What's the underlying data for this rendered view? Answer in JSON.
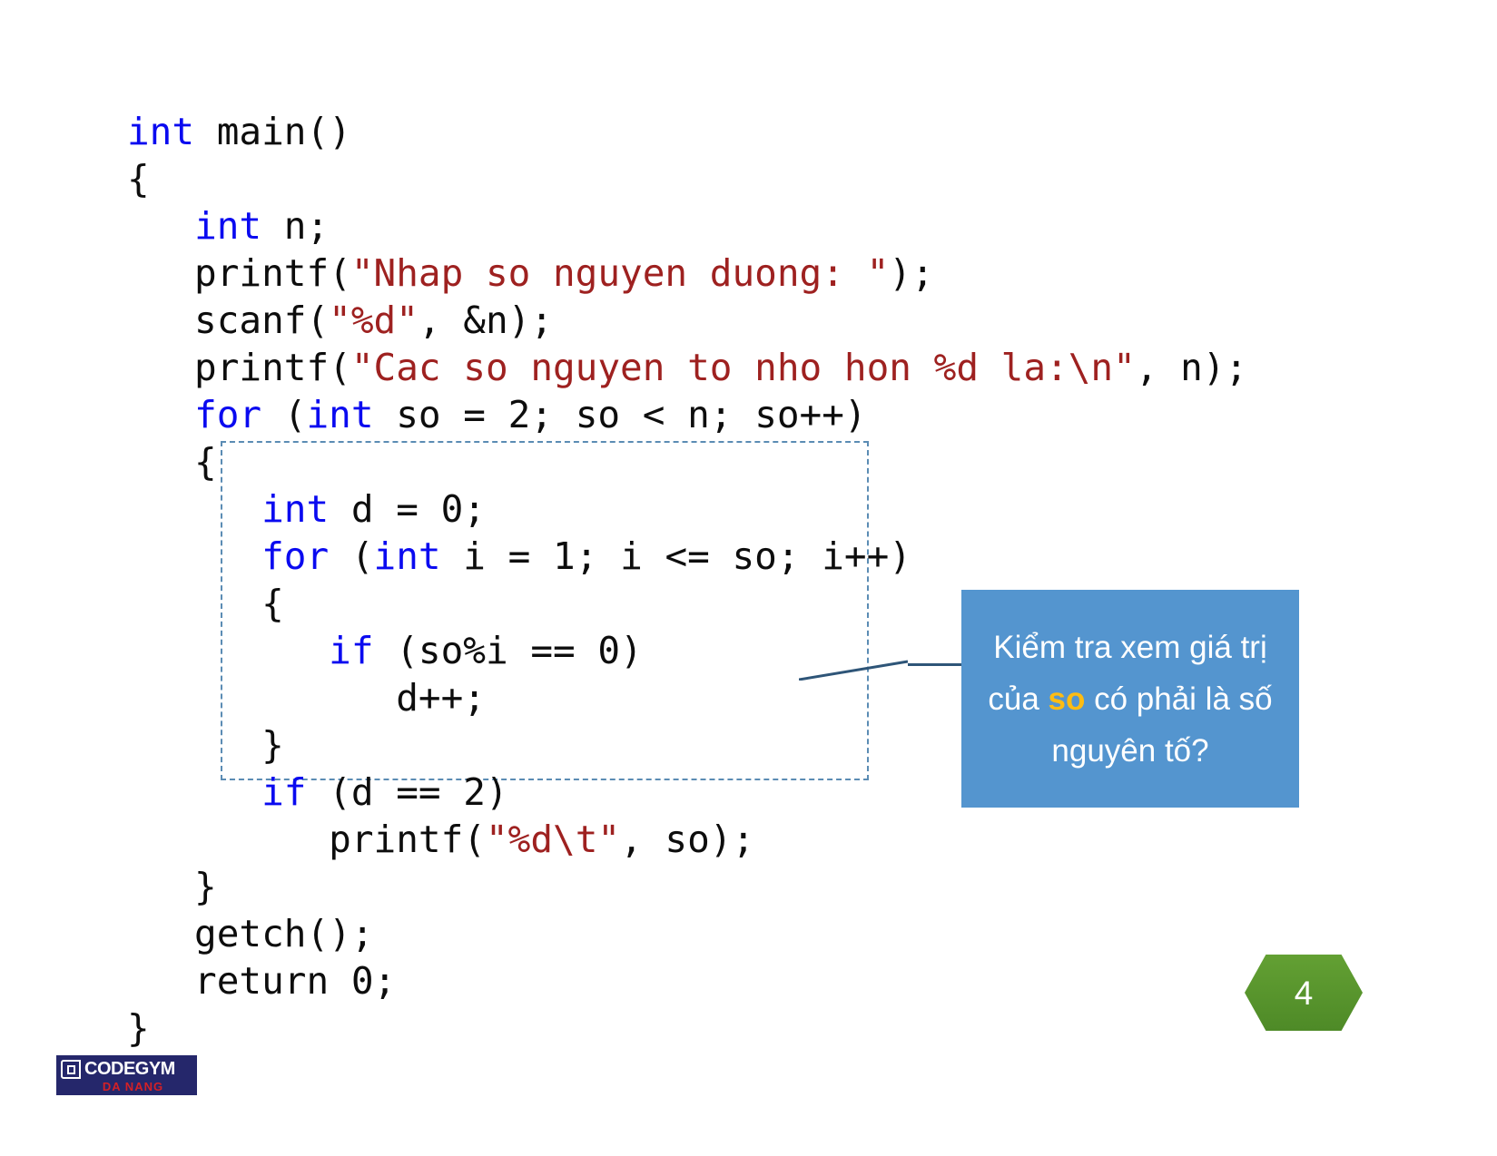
{
  "slide": {
    "page_number": "4",
    "background": "#ffffff"
  },
  "code": {
    "language": "c",
    "keyword_color": "#0a0af0",
    "string_color": "#9e2120",
    "plain_color": "#0d0d0d",
    "lines": [
      "int main()",
      "{",
      "   int n;",
      "   printf(\"Nhap so nguyen duong: \");",
      "   scanf(\"%d\", &n);",
      "   printf(\"Cac so nguyen to nho hon %d la:\\n\", n);",
      "   for (int so = 2; so < n; so++)",
      "   {",
      "      int d = 0;",
      "      for (int i = 1; i <= so; i++)",
      "      {",
      "         if (so%i == 0)",
      "            d++;",
      "      }",
      "      if (d == 2)",
      "         printf(\"%d\\t\", so);",
      "   }",
      "   getch();",
      "   return 0;",
      "}"
    ]
  },
  "highlight_box": {
    "label": "dashed-highlight-region",
    "border_color": "#5b8cb4",
    "style": "dashed",
    "covers_lines": "int d = 0; ... if (d == 2)"
  },
  "callout": {
    "background": "#5495cf",
    "text_color": "#ffffff",
    "highlight_color": "#fdbc13",
    "part1": "Kiểm tra xem giá trị của ",
    "highlight": "so",
    "part2": " có phải là số nguyên tố?",
    "full_text": "Kiểm tra xem giá trị của so có phải là số nguyên tố?",
    "connector_color": "#2e5578"
  },
  "page_badge": {
    "number": "4",
    "shape": "hexagon",
    "color_top": "#63a033",
    "color_bottom": "#4e8a27",
    "text_color": "#ffffff"
  },
  "logo": {
    "name": "CODEGYM",
    "subtitle": "DA NANG",
    "background": "#25276b",
    "word_color": "#ffffff",
    "subtitle_color": "#d42026"
  }
}
